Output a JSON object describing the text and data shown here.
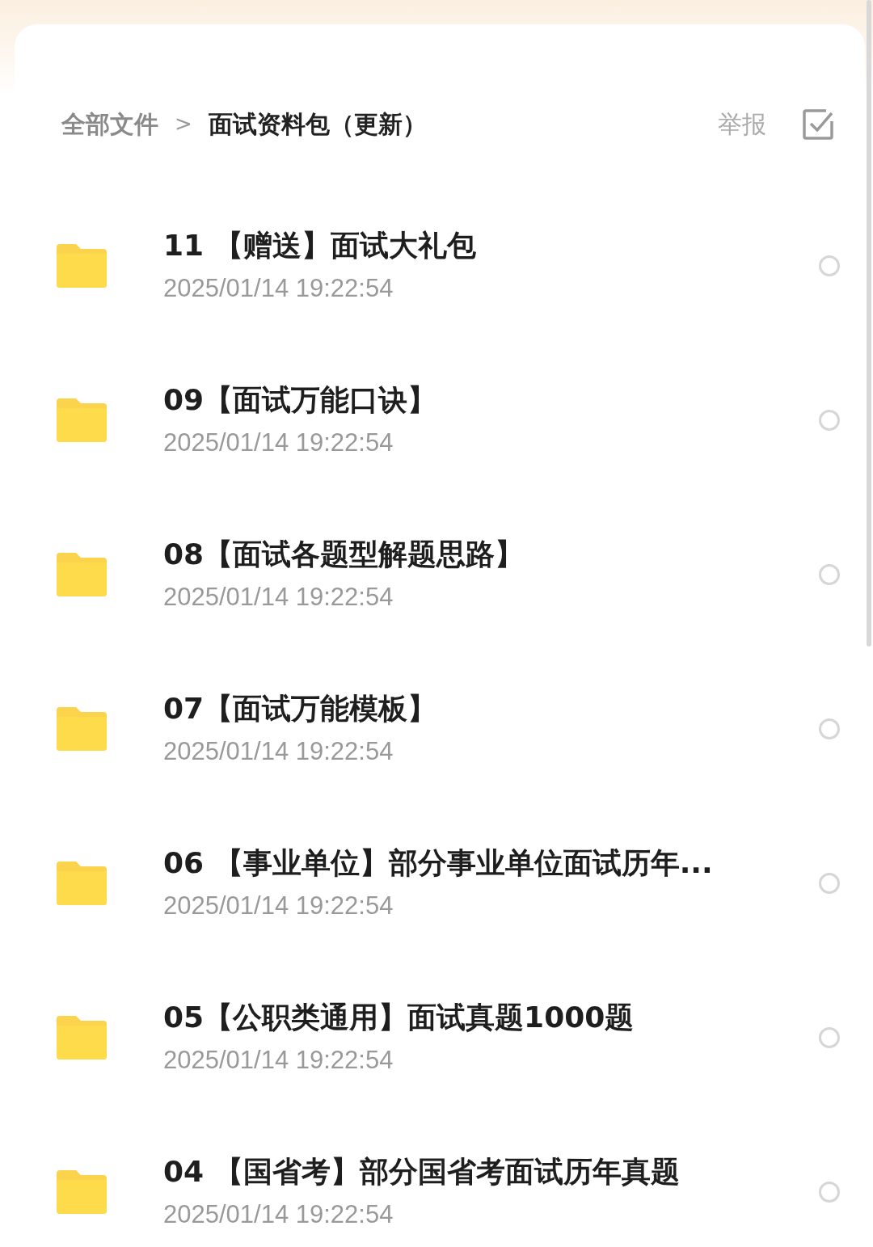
{
  "breadcrumb": [
    {
      "label": "全部文件",
      "current": false
    },
    {
      "label": "面试资料包（更新）",
      "current": true
    }
  ],
  "breadcrumb_separator": ">",
  "report": "举报",
  "files": [
    {
      "name": "11 【赠送】面试大礼包",
      "date": "2025/01/14 19:22:54",
      "selected": false
    },
    {
      "name": "09【面试万能口诀】",
      "date": "2025/01/14 19:22:54",
      "selected": false
    },
    {
      "name": "08【面试各题型解题思路】",
      "date": "2025/01/14 19:22:54",
      "selected": false
    },
    {
      "name": "07【面试万能模板】",
      "date": "2025/01/14 19:22:54",
      "selected": false
    },
    {
      "name": "06 【事业单位】部分事业单位面试历年...",
      "date": "2025/01/14 19:22:54",
      "selected": false
    },
    {
      "name": "05【公职类通用】面试真题1000题",
      "date": "2025/01/14 19:22:54",
      "selected": false
    },
    {
      "name": "04 【国省考】部分国省考面试历年真题",
      "date": "2025/01/14 19:22:54",
      "selected": false
    }
  ]
}
